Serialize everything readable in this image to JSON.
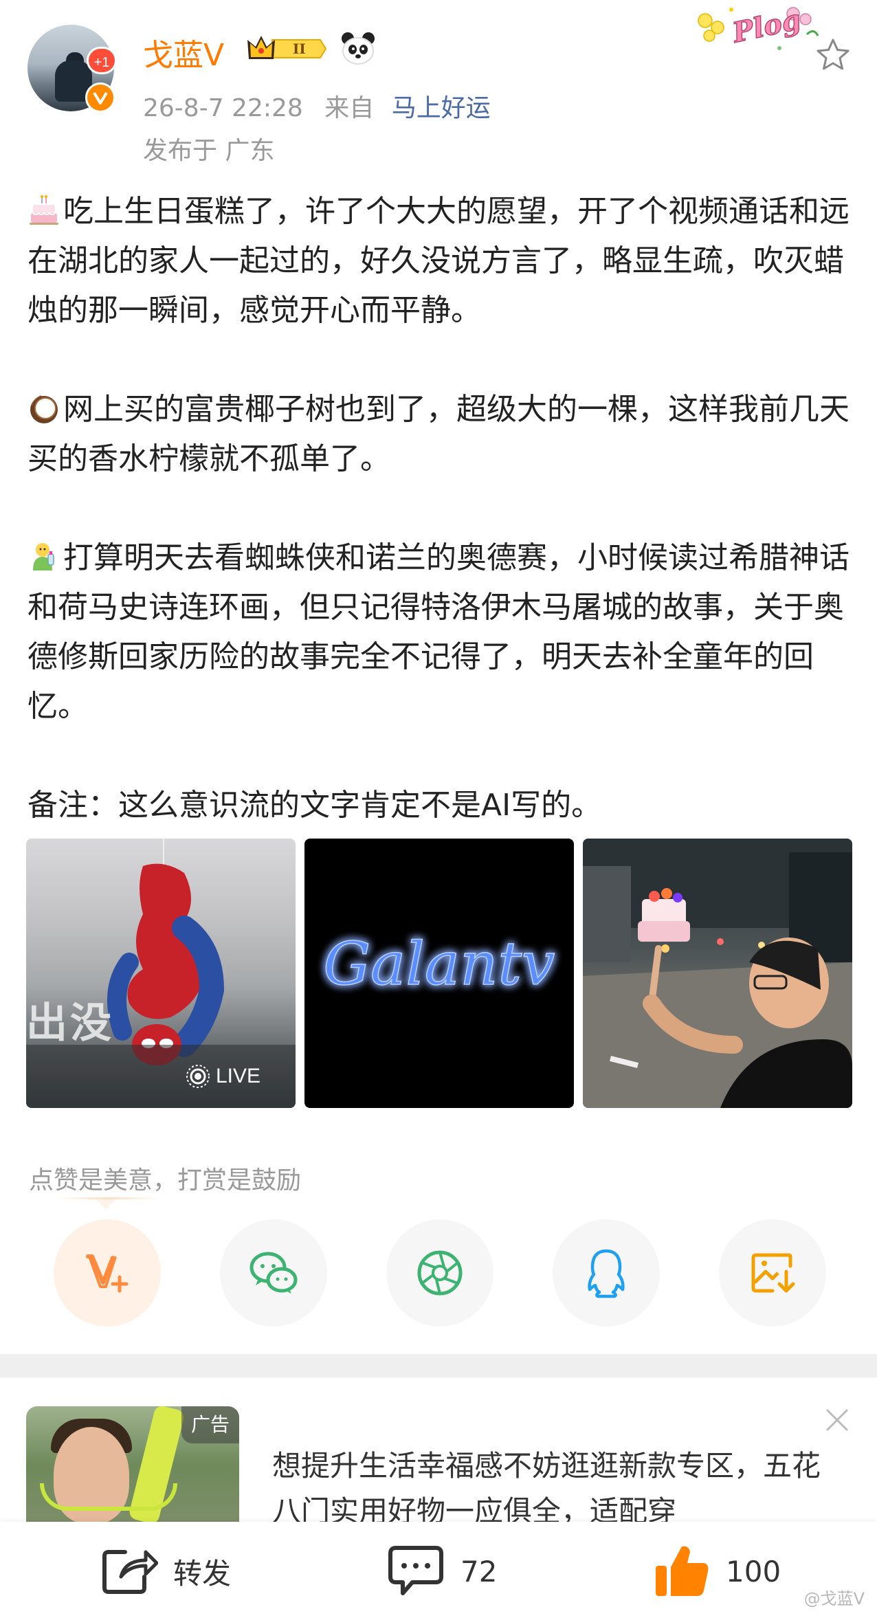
{
  "header": {
    "username": "戈蓝V",
    "avatar_notice": "+1",
    "crown_level": "II",
    "timestamp": "26-8-7 22:28",
    "source_label": "来自",
    "source_app": "马上好运",
    "location_line": "发布于  广东",
    "sticker_text": "Plog"
  },
  "post": {
    "paragraphs": [
      {
        "icon": "birthday-cake-emoji",
        "text": "吃上生日蛋糕了，许了个大大的愿望，开了个视频通话和远在湖北的家人一起过的，好久没说方言了，略显生疏，吹灭蜡烛的那一瞬间，感觉开心而平静。"
      },
      {
        "icon": "coconut-emoji",
        "text": "网上买的富贵椰子树也到了，超级大的一棵，这样我前几天买的香水柠檬就不孤单了。"
      },
      {
        "icon": "baby-feeding-emoji",
        "text": "打算明天去看蜘蛛侠和诺兰的奥德赛，小时候读过希腊神话和荷马史诗连环画，但只记得特洛伊木马屠城的故事，关于奥德修斯回家历险的故事完全不记得了，明天去补全童年的回忆。"
      },
      {
        "icon": "",
        "text": "备注：这么意识流的文字肯定不是AI写的。"
      }
    ]
  },
  "images": {
    "tile1_overlay": "出没",
    "tile1_live": "LIVE",
    "tile2_neon": "Galantv"
  },
  "reward": {
    "text": "点赞是美意，打赏是鼓励"
  },
  "share_targets": [
    {
      "icon": "v-plus-icon"
    },
    {
      "icon": "wechat-icon"
    },
    {
      "icon": "moments-icon"
    },
    {
      "icon": "qq-icon"
    },
    {
      "icon": "save-image-icon"
    }
  ],
  "ad": {
    "tag": "广告",
    "text": "想提升生活幸福感不妨逛逛新款专区，五花八门实用好物一应俱全，适配穿"
  },
  "bottom_bar": {
    "repost_label": "转发",
    "comment_count": "72",
    "like_count": "100",
    "watermark": "@戈蓝V"
  },
  "colors": {
    "username": "#ff7a00",
    "source_link": "#4a6aa5",
    "meta_gray": "#999999",
    "like_orange": "#ff8200"
  }
}
